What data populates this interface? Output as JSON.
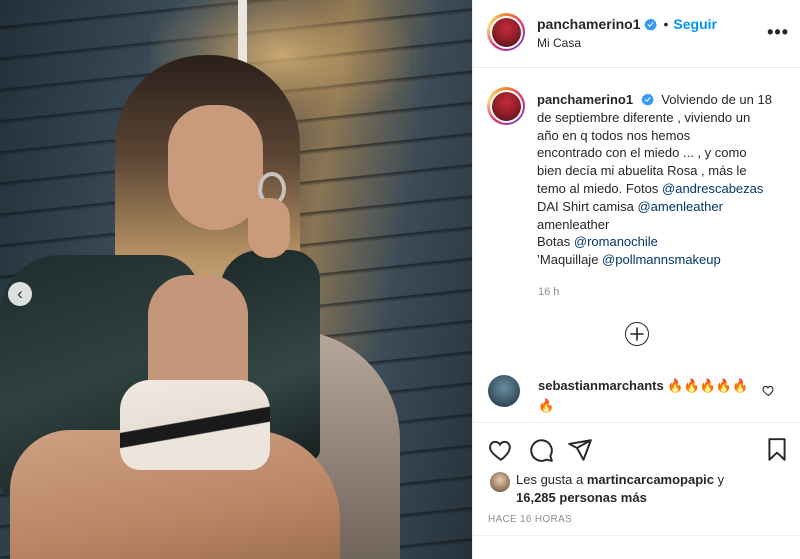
{
  "post": {
    "username": "panchamerino1",
    "follow_label": "Seguir",
    "separator": "•",
    "location": "Mi Casa",
    "more_label": "•••"
  },
  "caption": {
    "username": "panchamerino1",
    "lines": [
      "Volviendo de un 18",
      "de septiembre diferente , viviendo un",
      "año en q todos nos hemos",
      "encontrado con el miedo ... , y como",
      "bien decía mi abuelita Rosa , más le",
      "temo al miedo. Fotos"
    ],
    "mention_photos": "@andrescabezas",
    "line_dai": "DAI Shirt camisa",
    "mention_amen": "@amenleather",
    "line_amen": "amenleather",
    "line_botas": "Botas",
    "mention_romano": "@romanochile",
    "line_maq": "’Maquillaje",
    "mention_pollmann": "@pollmannsmakeup",
    "time": "16 h"
  },
  "comments": [
    {
      "username": "sebastianmarchants",
      "text": "🔥🔥🔥🔥🔥🔥"
    }
  ],
  "likes": {
    "prefix": "Les gusta a",
    "user": "martincarcamopapic",
    "joiner": "y",
    "count_text": "16,285 personas más"
  },
  "date": "HACE 16 HORAS",
  "colors": {
    "link": "#0095f6",
    "mention": "#00376b",
    "muted": "#8e8e8e",
    "text": "#262626"
  },
  "icons": [
    "chevron-left-icon",
    "verified-icon",
    "more-icon",
    "add-circle-icon",
    "heart-icon",
    "comment-icon",
    "share-icon",
    "bookmark-icon"
  ]
}
